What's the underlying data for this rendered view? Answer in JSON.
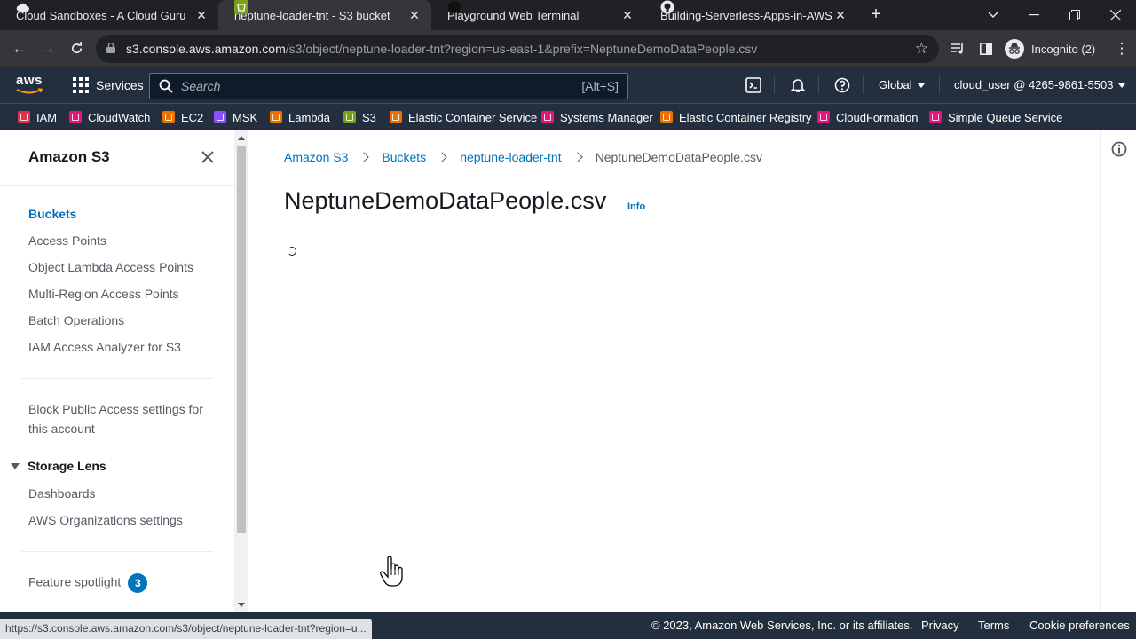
{
  "browser": {
    "tabs": [
      {
        "title": "Cloud Sandboxes - A Cloud Guru",
        "icon": "cloud-icon"
      },
      {
        "title": "neptune-loader-tnt - S3 bucket",
        "icon": "s3-bucket-icon"
      },
      {
        "title": "Playground Web Terminal",
        "icon": "terminal-icon"
      },
      {
        "title": "Building-Serverless-Apps-in-AWS",
        "icon": "github-icon"
      }
    ],
    "url_host": "s3.console.aws.amazon.com",
    "url_path": "/s3/object/neptune-loader-tnt?region=us-east-1&prefix=NeptuneDemoDataPeople.csv",
    "incognito_label": "Incognito (2)"
  },
  "aws_header": {
    "logo_text": "aws",
    "services_label": "Services",
    "search_placeholder": "Search",
    "search_shortcut": "[Alt+S]",
    "region": "Global",
    "account": "cloud_user @ 4265-9861-5503"
  },
  "favorites": [
    {
      "label": "IAM",
      "color": "#dd344c"
    },
    {
      "label": "CloudWatch",
      "color": "#e7157b"
    },
    {
      "label": "EC2",
      "color": "#ed7100"
    },
    {
      "label": "MSK",
      "color": "#8c4fff"
    },
    {
      "label": "Lambda",
      "color": "#ed7100"
    },
    {
      "label": "S3",
      "color": "#7aa116"
    },
    {
      "label": "Elastic Container Service",
      "color": "#ed7100"
    },
    {
      "label": "Systems Manager",
      "color": "#e7157b"
    },
    {
      "label": "Elastic Container Registry",
      "color": "#ed7100"
    },
    {
      "label": "CloudFormation",
      "color": "#e7157b"
    },
    {
      "label": "Simple Queue Service",
      "color": "#e7157b"
    }
  ],
  "sidebar": {
    "title": "Amazon S3",
    "items": [
      "Buckets",
      "Access Points",
      "Object Lambda Access Points",
      "Multi-Region Access Points",
      "Batch Operations",
      "IAM Access Analyzer for S3"
    ],
    "block_public_access": "Block Public Access settings for this account",
    "storage_lens": {
      "label": "Storage Lens",
      "items": [
        "Dashboards",
        "AWS Organizations settings"
      ]
    },
    "feature_spotlight": {
      "label": "Feature spotlight",
      "count": "3"
    }
  },
  "main": {
    "breadcrumbs": [
      "Amazon S3",
      "Buckets",
      "neptune-loader-tnt",
      "NeptuneDemoDataPeople.csv"
    ],
    "title": "NeptuneDemoDataPeople.csv",
    "info_link": "Info"
  },
  "footer": {
    "copyright": "© 2023, Amazon Web Services, Inc. or its affiliates.",
    "links": [
      "Privacy",
      "Terms",
      "Cookie preferences"
    ]
  },
  "status_url": "https://s3.console.aws.amazon.com/s3/object/neptune-loader-tnt?region=u..."
}
